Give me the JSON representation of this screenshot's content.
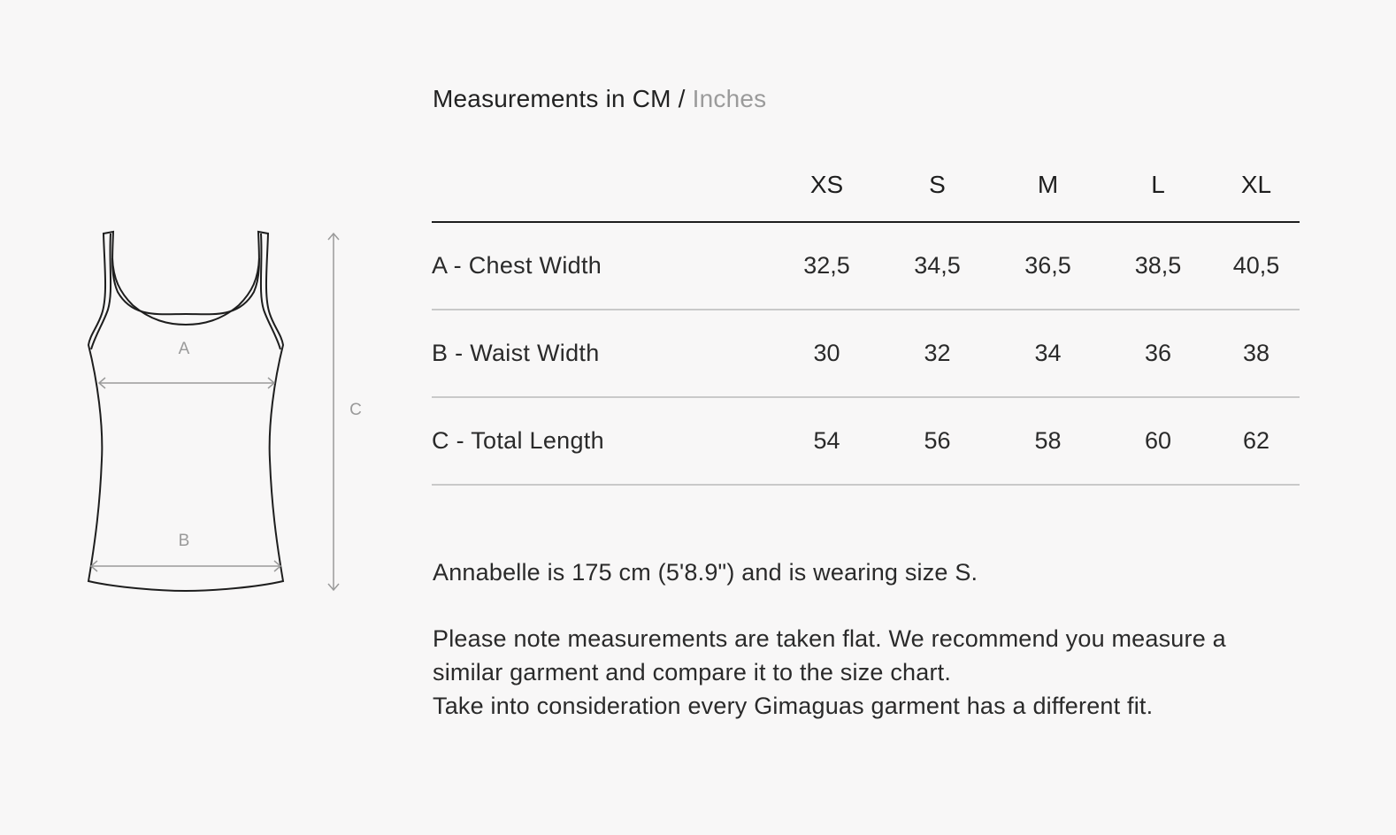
{
  "units": {
    "active": "Measurements in CM",
    "separator": " / ",
    "inactive": "Inches"
  },
  "diagram": {
    "labels": {
      "a": "A",
      "b": "B",
      "c": "C"
    }
  },
  "table": {
    "sizes": [
      "XS",
      "S",
      "M",
      "L",
      "XL"
    ],
    "rows": [
      {
        "label": "A - Chest Width",
        "values": [
          "32,5",
          "34,5",
          "36,5",
          "38,5",
          "40,5"
        ]
      },
      {
        "label": "B - Waist Width",
        "values": [
          "30",
          "32",
          "34",
          "36",
          "38"
        ]
      },
      {
        "label": "C - Total Length",
        "values": [
          "54",
          "56",
          "58",
          "60",
          "62"
        ]
      }
    ]
  },
  "notes": {
    "model": "Annabelle is 175 cm (5'8.9\") and is wearing size S.",
    "line1": "Please note measurements are taken flat. We recommend you measure a",
    "line2": "similar garment and compare it to the size chart.",
    "line3": "Take into consideration every Gimaguas garment has a different fit."
  }
}
